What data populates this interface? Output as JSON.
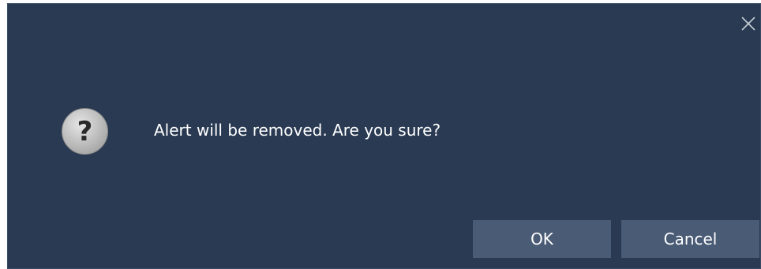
{
  "dialog": {
    "message": "Alert will be removed. Are you sure?",
    "ok_label": "OK",
    "cancel_label": "Cancel",
    "icons": {
      "close": "close-icon",
      "question": "question-icon"
    },
    "colors": {
      "background": "#293a52",
      "button": "#4a5b75",
      "text": "#ffffff",
      "icon_circle": "#c9c9c9"
    }
  }
}
